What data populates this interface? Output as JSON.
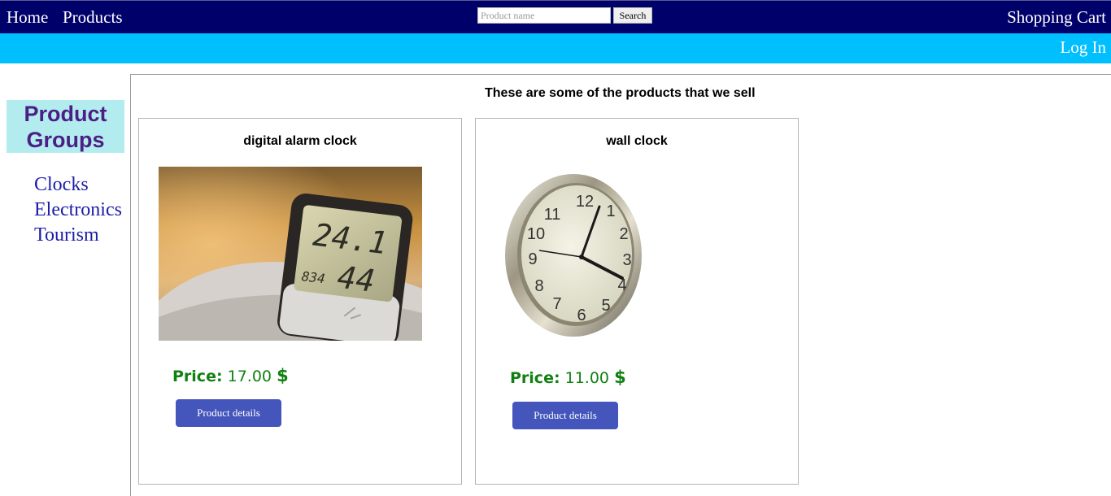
{
  "nav": {
    "home": "Home",
    "products": "Products",
    "cart": "Shopping Cart",
    "login": "Log In"
  },
  "search": {
    "placeholder": "Product name",
    "value": "",
    "button": "Search"
  },
  "sidebar": {
    "title": "Product Groups",
    "groups": [
      {
        "label": "Clocks"
      },
      {
        "label": "Electronics"
      },
      {
        "label": "Tourism"
      }
    ]
  },
  "main": {
    "heading": "These are some of the products that we sell",
    "products": [
      {
        "name": "digital alarm clock",
        "price_label": "Price:",
        "price_value": "17.00",
        "currency": "$",
        "button": "Product details",
        "image_icon": "digital-clock-photo"
      },
      {
        "name": "wall clock",
        "price_label": "Price:",
        "price_value": "11.00",
        "currency": "$",
        "button": "Product details",
        "image_icon": "wall-clock-photo"
      }
    ]
  },
  "colors": {
    "nav_bg": "#00006b",
    "subbar_bg": "#00bfff",
    "group_title_bg": "#b3ecee",
    "group_title_text": "#4b1f86",
    "group_link": "#1c1ca8",
    "price_green": "#118011",
    "button_bg": "#4455bb"
  }
}
